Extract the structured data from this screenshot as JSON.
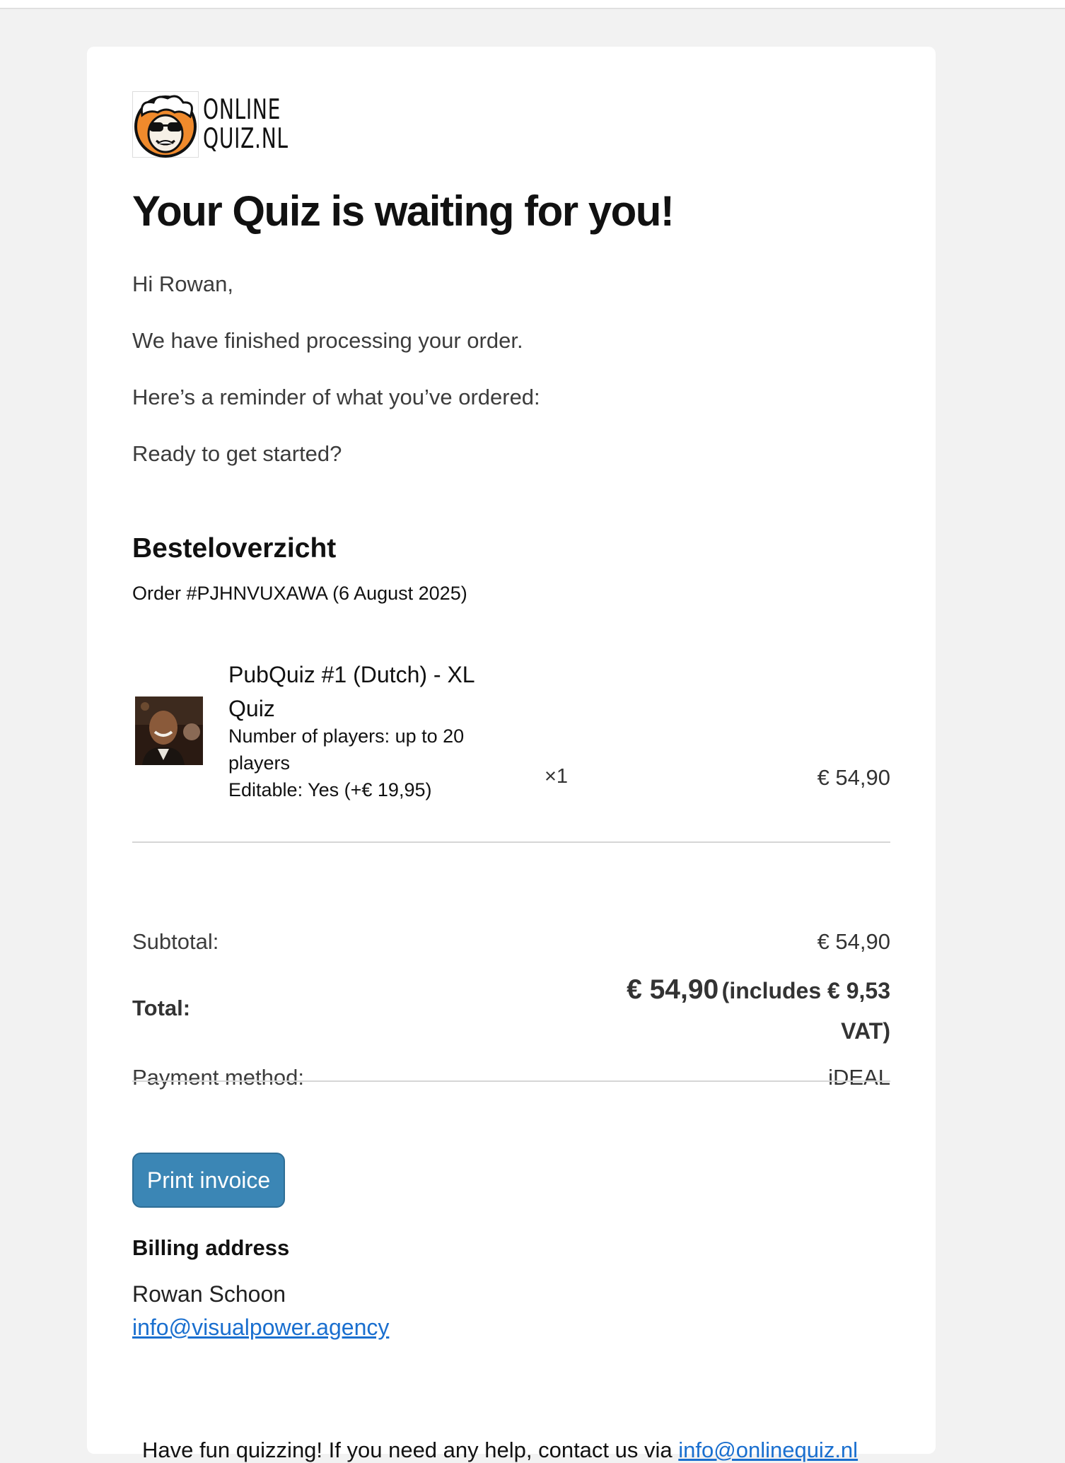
{
  "logo": {
    "line1": "ONLINE",
    "line2": "QUIZ.NL",
    "icon": "quiz-mascot-icon"
  },
  "heading": "Your Quiz is waiting for you!",
  "greeting": "Hi Rowan,",
  "message": "We have finished processing your order.",
  "reminder": "Here’s a reminder of what you’ve ordered:",
  "prompt": "Ready to get started?",
  "summary": {
    "title": "Besteloverzicht",
    "order_line": "Order #PJHNVUXAWA (6 August 2025)"
  },
  "item": {
    "name": "PubQuiz #1 (Dutch) - XL Quiz",
    "meta_players": "Number of players: up to 20 players",
    "meta_editable": "Editable: Yes (+€ 19,95)",
    "quantity": "×1",
    "price": "€ 54,90"
  },
  "totals": {
    "subtotal_label": "Subtotal:",
    "subtotal_value": "€ 54,90",
    "total_label": "Total:",
    "total_value": "€ 54,90",
    "total_vat": "(includes € 9,53 VAT)",
    "payment_label": "Payment method:",
    "payment_value": "iDEAL"
  },
  "print_button": "Print invoice",
  "billing": {
    "title": "Billing address",
    "name": "Rowan Schoon",
    "email": "info@visualpower.agency"
  },
  "footer": {
    "text": "Have fun quizzing! If you need any help, contact us via",
    "email": "info@onlinequiz.nl"
  },
  "colors": {
    "button": "#3b86b5",
    "link": "#1a6fcf",
    "logo_orange": "#f08a2c"
  }
}
